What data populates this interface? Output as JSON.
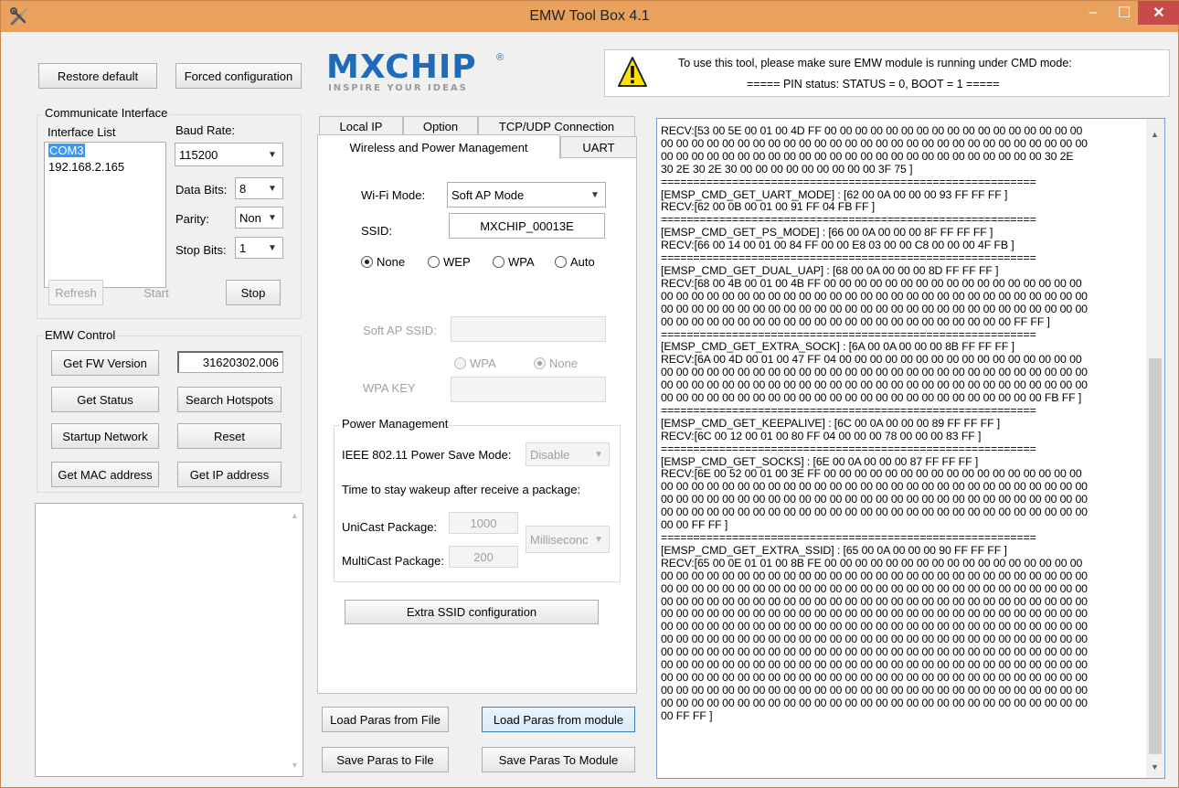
{
  "window": {
    "title": "EMW Tool Box 4.1"
  },
  "titlebar": {
    "minimize": "–",
    "maximize": "☐",
    "close": "✕"
  },
  "top": {
    "restore_default": "Restore default",
    "forced_configuration": "Forced configuration",
    "logo_text": "MXCHIP",
    "logo_reg": "®",
    "logo_tagline": "INSPIRE YOUR IDEAS",
    "notice_line1": "To use this tool, please make sure EMW module is running under CMD mode:",
    "notice_line2": "===== PIN status: STATUS = 0, BOOT = 1 ====="
  },
  "communicate": {
    "group_title": "Communicate Interface",
    "interface_list_label": "Interface List",
    "interfaces": [
      "COM3",
      "192.168.2.165"
    ],
    "baud_rate_label": "Baud Rate:",
    "baud_rate_value": "115200",
    "data_bits_label": "Data Bits:",
    "data_bits_value": "8",
    "parity_label": "Parity:",
    "parity_value": "Non",
    "stop_bits_label": "Stop Bits:",
    "stop_bits_value": "1",
    "refresh": "Refresh",
    "start": "Start",
    "stop": "Stop"
  },
  "emw_control": {
    "group_title": "EMW Control",
    "get_fw_version": "Get FW Version",
    "fw_version_value": "31620302.006",
    "get_status": "Get Status",
    "search_hotspots": "Search Hotspots",
    "startup_network": "Startup Network",
    "reset": "Reset",
    "get_mac_address": "Get MAC address",
    "get_ip_address": "Get IP address"
  },
  "tabs": {
    "row1": [
      "Local IP",
      "Option",
      "TCP/UDP Connection"
    ],
    "row2": [
      "Wireless and Power Management",
      "UART"
    ]
  },
  "wireless": {
    "wifi_mode_label": "Wi-Fi Mode:",
    "wifi_mode_value": "Soft AP Mode",
    "ssid_label": "SSID:",
    "ssid_value": "MXCHIP_00013E",
    "security": [
      "None",
      "WEP",
      "WPA",
      "Auto"
    ],
    "soft_ap_ssid_label": "Soft AP SSID:",
    "soft_ap_security": [
      "WPA",
      "None"
    ],
    "wpa_key_label": "WPA KEY"
  },
  "power": {
    "group_title": "Power Management",
    "ps_mode_label": "IEEE 802.11 Power Save Mode:",
    "ps_mode_value": "Disable",
    "wakeup_label": "Time to stay wakeup after receive a package:",
    "unicast_label": "UniCast Package:",
    "unicast_value": "1000",
    "multicast_label": "MultiCast Package:",
    "multicast_value": "200",
    "unit_value": "Milliseconc",
    "extra_ssid": "Extra SSID configuration"
  },
  "params": {
    "load_from_file": "Load Paras from File",
    "load_from_module": "Load Paras from module",
    "save_to_file": "Save Paras to File",
    "save_to_module": "Save Paras To Module"
  },
  "log": {
    "lines": [
      "RECV:[53 00 5E 00 01 00 4D FF 00 00 00 00 00 00 00 00 00 00 00 00 00 00 00 00 00",
      "00 00 00 00 00 00 00 00 00 00 00 00 00 00 00 00 00 00 00 00 00 00 00 00 00 00 00 00",
      "00 00 00 00 00 00 00 00 00 00 00 00 00 00 00 00 00 00 00 00 00 00 00 00 00 30 2E",
      "30 2E 30 2E 30 00 00 00 00 00 00 00 00 00 3F 75 ]",
      "==========================================================",
      "[EMSP_CMD_GET_UART_MODE] : [62 00 0A 00 00 00 93 FF FF FF ]",
      "RECV:[62 00 0B 00 01 00 91 FF 04 FB FF ]",
      "==========================================================",
      "[EMSP_CMD_GET_PS_MODE] : [66 00 0A 00 00 00 8F FF FF FF ]",
      "RECV:[66 00 14 00 01 00 84 FF 00 00 E8 03 00 00 C8 00 00 00 4F FB ]",
      "==========================================================",
      "[EMSP_CMD_GET_DUAL_UAP] : [68 00 0A 00 00 00 8D FF FF FF ]",
      "RECV:[68 00 4B 00 01 00 4B FF 00 00 00 00 00 00 00 00 00 00 00 00 00 00 00 00 00",
      "00 00 00 00 00 00 00 00 00 00 00 00 00 00 00 00 00 00 00 00 00 00 00 00 00 00 00 00",
      "00 00 00 00 00 00 00 00 00 00 00 00 00 00 00 00 00 00 00 00 00 00 00 00 00 00 00 00",
      "00 00 00 00 00 00 00 00 00 00 00 00 00 00 00 00 00 00 00 00 00 00 00 FF FF ]",
      "==========================================================",
      "[EMSP_CMD_GET_EXTRA_SOCK] : [6A 00 0A 00 00 00 8B FF FF FF ]",
      "RECV:[6A 00 4D 00 01 00 47 FF 04 00 00 00 00 00 00 00 00 00 00 00 00 00 00 00 00",
      "00 00 00 00 00 00 00 00 00 00 00 00 00 00 00 00 00 00 00 00 00 00 00 00 00 00 00 00",
      "00 00 00 00 00 00 00 00 00 00 00 00 00 00 00 00 00 00 00 00 00 00 00 00 00 00 00 00",
      "00 00 00 00 00 00 00 00 00 00 00 00 00 00 00 00 00 00 00 00 00 00 00 00 00 FB FF ]",
      "==========================================================",
      "[EMSP_CMD_GET_KEEPALIVE] : [6C 00 0A 00 00 00 89 FF FF FF ]",
      "RECV:[6C 00 12 00 01 00 80 FF 04 00 00 00 78 00 00 00 83 FF ]",
      "==========================================================",
      "[EMSP_CMD_GET_SOCKS] : [6E 00 0A 00 00 00 87 FF FF FF ]",
      "RECV:[6E 00 52 00 01 00 3E FF 00 00 00 00 00 00 00 00 00 00 00 00 00 00 00 00 00",
      "00 00 00 00 00 00 00 00 00 00 00 00 00 00 00 00 00 00 00 00 00 00 00 00 00 00 00 00",
      "00 00 00 00 00 00 00 00 00 00 00 00 00 00 00 00 00 00 00 00 00 00 00 00 00 00 00 00",
      "00 00 00 00 00 00 00 00 00 00 00 00 00 00 00 00 00 00 00 00 00 00 00 00 00 00 00 00",
      "00 00 FF FF ]",
      "==========================================================",
      "[EMSP_CMD_GET_EXTRA_SSID] : [65 00 0A 00 00 00 90 FF FF FF ]",
      "RECV:[65 00 0E 01 01 00 8B FE 00 00 00 00 00 00 00 00 00 00 00 00 00 00 00 00 00",
      "00 00 00 00 00 00 00 00 00 00 00 00 00 00 00 00 00 00 00 00 00 00 00 00 00 00 00 00",
      "00 00 00 00 00 00 00 00 00 00 00 00 00 00 00 00 00 00 00 00 00 00 00 00 00 00 00 00",
      "00 00 00 00 00 00 00 00 00 00 00 00 00 00 00 00 00 00 00 00 00 00 00 00 00 00 00 00",
      "00 00 00 00 00 00 00 00 00 00 00 00 00 00 00 00 00 00 00 00 00 00 00 00 00 00 00 00",
      "00 00 00 00 00 00 00 00 00 00 00 00 00 00 00 00 00 00 00 00 00 00 00 00 00 00 00 00",
      "00 00 00 00 00 00 00 00 00 00 00 00 00 00 00 00 00 00 00 00 00 00 00 00 00 00 00 00",
      "00 00 00 00 00 00 00 00 00 00 00 00 00 00 00 00 00 00 00 00 00 00 00 00 00 00 00 00",
      "00 00 00 00 00 00 00 00 00 00 00 00 00 00 00 00 00 00 00 00 00 00 00 00 00 00 00 00",
      "00 00 00 00 00 00 00 00 00 00 00 00 00 00 00 00 00 00 00 00 00 00 00 00 00 00 00 00",
      "00 00 00 00 00 00 00 00 00 00 00 00 00 00 00 00 00 00 00 00 00 00 00 00 00 00 00 00",
      "00 00 00 00 00 00 00 00 00 00 00 00 00 00 00 00 00 00 00 00 00 00 00 00 00 00 00 00",
      "00 FF FF ]"
    ]
  },
  "icons": {
    "app": "tools-icon",
    "warning": "warning-icon",
    "scroll_up": "▲",
    "scroll_down": "▼",
    "dropdown": "▼"
  },
  "colors": {
    "titlebar": "#e8a25e",
    "close": "#c74b4b",
    "selection": "#3399ff",
    "logo_blue": "#1e6bb8",
    "warning_yellow": "#ffe100"
  }
}
